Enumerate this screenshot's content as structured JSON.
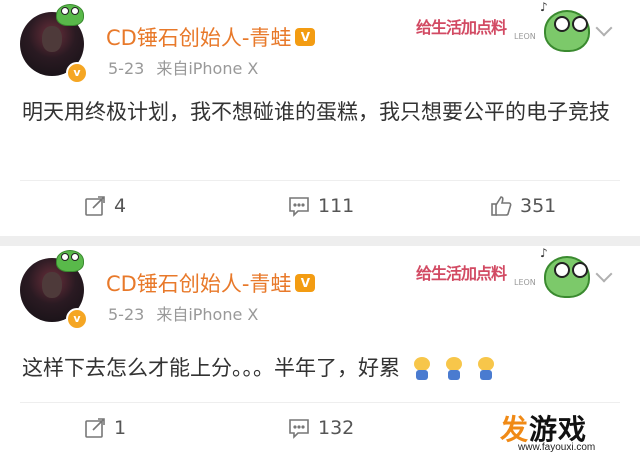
{
  "posts": [
    {
      "author": "CD锤石创始人-青蛙",
      "date": "5-23",
      "source": "来自iPhone X",
      "card_text": "给生活加点料",
      "card_sub": "LEON",
      "content": "明天用终极计划，我不想碰谁的蛋糕，我只想要公平的电子竞技",
      "reposts": "4",
      "comments": "111",
      "likes": "351"
    },
    {
      "author": "CD锤石创始人-青蛙",
      "date": "5-23",
      "source": "来自iPhone X",
      "card_text": "给生活加点料",
      "card_sub": "LEON",
      "content": "这样下去怎么才能上分。。。半年了，好累",
      "reposts": "1",
      "comments": "132",
      "likes": ""
    }
  ],
  "watermark": {
    "char1": "发",
    "rest": "游戏",
    "url": "www.fayouxi.com"
  },
  "colors": {
    "name": "#e8792a",
    "meta": "#999999",
    "text": "#333333",
    "badge": "#f5a623"
  },
  "icons": [
    "avatar",
    "verified-badge-icon",
    "vip-icon",
    "chevron-down-icon",
    "repost-icon",
    "comment-icon",
    "like-icon",
    "tired-emoji-icon"
  ]
}
